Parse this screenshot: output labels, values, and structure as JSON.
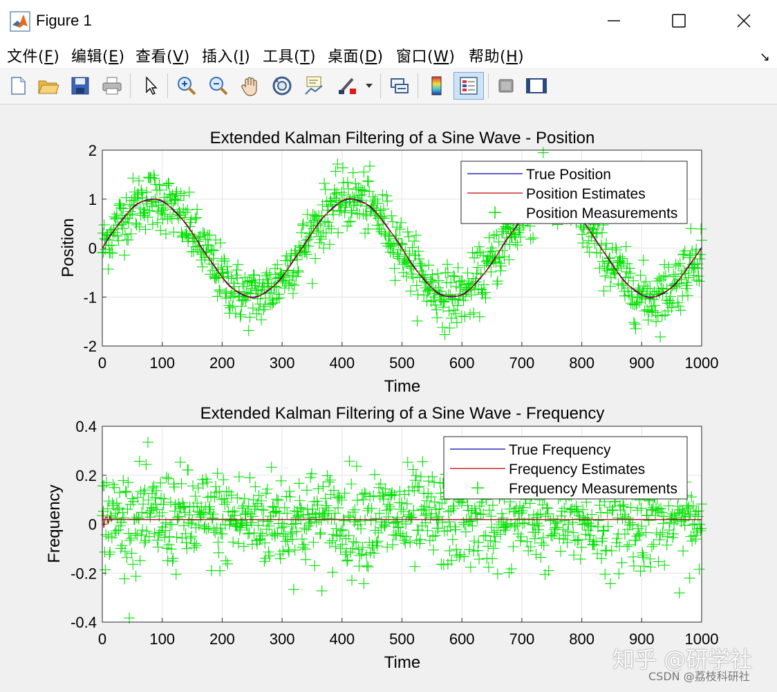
{
  "window": {
    "title": "Figure 1",
    "minimize_glyph": "—",
    "maximize_glyph": "☐",
    "close_glyph": "✕"
  },
  "menu": {
    "items": [
      {
        "name": "file",
        "text": "文件(",
        "key": "F",
        "tail": ")"
      },
      {
        "name": "edit",
        "text": "编辑(",
        "key": "E",
        "tail": ")"
      },
      {
        "name": "view",
        "text": "查看(",
        "key": "V",
        "tail": ")"
      },
      {
        "name": "insert",
        "text": "插入(",
        "key": "I",
        "tail": ")"
      },
      {
        "name": "tools",
        "text": "工具(",
        "key": "T",
        "tail": ")"
      },
      {
        "name": "desktop",
        "text": "桌面(",
        "key": "D",
        "tail": ")"
      },
      {
        "name": "window",
        "text": "窗口(",
        "key": "W",
        "tail": ")"
      },
      {
        "name": "help",
        "text": "帮助(",
        "key": "H",
        "tail": ")"
      }
    ],
    "corner_icon": "↘"
  },
  "toolbar": {
    "icons": [
      "new-file-icon",
      "open-folder-icon",
      "save-icon",
      "print-icon",
      "pointer-icon",
      "zoom-in-icon",
      "zoom-out-icon",
      "pan-hand-icon",
      "rotate-3d-icon",
      "data-tips-icon",
      "brush-icon",
      "link-plot-icon",
      "colorbar-icon",
      "legend-icon",
      "hide-plot-tools-icon",
      "show-plot-tools-icon"
    ]
  },
  "chart_data": [
    {
      "type": "line",
      "title": "Extended Kalman Filtering of a Sine Wave - Position",
      "xlabel": "Time",
      "ylabel": "Position",
      "xlim": [
        0,
        1000
      ],
      "ylim": [
        -2,
        2
      ],
      "xticks": [
        "0",
        "100",
        "200",
        "300",
        "400",
        "500",
        "600",
        "700",
        "800",
        "900",
        "1000"
      ],
      "yticks": [
        "2",
        "1",
        "0",
        "-1",
        "-2"
      ],
      "grid": true,
      "legend_position": "top-right",
      "series": [
        {
          "name": "True Position",
          "color": "#0000aa",
          "style": "line",
          "model": {
            "kind": "sine",
            "amplitude": 1,
            "period": 333,
            "phase": 0
          }
        },
        {
          "name": "Position Estimates",
          "color": "#c00000",
          "style": "line",
          "model": {
            "kind": "sine",
            "amplitude": 1,
            "period": 333,
            "phase": 0
          }
        },
        {
          "name": "Position Measurements",
          "color": "#00e000",
          "style": "plus",
          "model": {
            "kind": "sine",
            "amplitude": 1,
            "period": 333,
            "noise_sd": 0.3,
            "count": 1000
          }
        }
      ]
    },
    {
      "type": "line",
      "title": "Extended Kalman Filtering of a Sine Wave - Frequency",
      "xlabel": "Time",
      "ylabel": "Frequency",
      "xlim": [
        0,
        1000
      ],
      "ylim": [
        -0.4,
        0.4
      ],
      "xticks": [
        "0",
        "100",
        "200",
        "300",
        "400",
        "500",
        "600",
        "700",
        "800",
        "900",
        "1000"
      ],
      "yticks": [
        "0.4",
        "0.2",
        "0",
        "-0.2",
        "-0.4"
      ],
      "grid": true,
      "legend_position": "top-right",
      "series": [
        {
          "name": "True Frequency",
          "color": "#0000aa",
          "style": "line",
          "model": {
            "kind": "constant",
            "value": 0.019
          }
        },
        {
          "name": "Frequency Estimates",
          "color": "#c00000",
          "style": "line",
          "model": {
            "kind": "constant",
            "value": 0.019
          }
        },
        {
          "name": "Frequency Measurements",
          "color": "#00e000",
          "style": "plus",
          "model": {
            "kind": "constant",
            "value": 0.019,
            "noise_sd": 0.1,
            "count": 1000
          }
        }
      ]
    }
  ],
  "watermark": {
    "line1": "知乎 @研学社",
    "line2": "CSDN @荔枝科研社"
  }
}
